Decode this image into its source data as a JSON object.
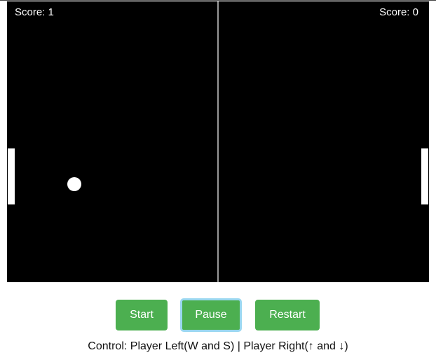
{
  "scoreboard": {
    "left": "Score: 1",
    "right": "Score: 0"
  },
  "controls": {
    "start_label": "Start",
    "pause_label": "Pause",
    "restart_label": "Restart"
  },
  "help_text": "Control: Player Left(W and S) | Player Right(↑ and ↓)",
  "colors": {
    "court": "#000000",
    "button": "#4caf50",
    "focus_ring": "#9ad7f0",
    "center_line": "#999999"
  }
}
